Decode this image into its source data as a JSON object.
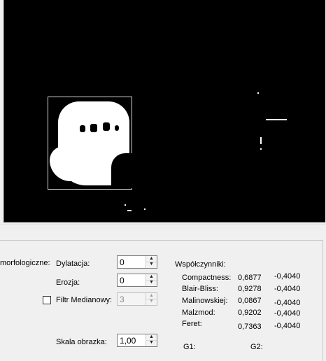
{
  "morph": {
    "group_label": "morfologiczne:",
    "dilation": {
      "label": "Dylatacja:",
      "value": "0"
    },
    "erosion": {
      "label": "Erozja:",
      "value": "0"
    },
    "median": {
      "label": "Filtr Medianowy:",
      "value": "3",
      "checked": false
    },
    "scale": {
      "label": "Skala obrazka:",
      "value": "1,00"
    }
  },
  "coefficients": {
    "title": "Współczynniki:",
    "rows": [
      {
        "name": "Compactness:",
        "v1": "0,6877",
        "v2": "-0,4040"
      },
      {
        "name": "Blair-Bliss:",
        "v1": "0,9278",
        "v2": "-0,4040"
      },
      {
        "name": "Malinowskiej:",
        "v1": "0,0867",
        "v2": "-0,4040"
      },
      {
        "name": "Malzmod:",
        "v1": "0,9202",
        "v2": "-0,4040"
      },
      {
        "name": "Feret:",
        "v1": "0,7363",
        "v2": "-0,4040"
      }
    ],
    "g1_label": "G1:",
    "g2_label": "G2:"
  },
  "icons": {
    "spin_up": "▲",
    "spin_down": "▼"
  }
}
